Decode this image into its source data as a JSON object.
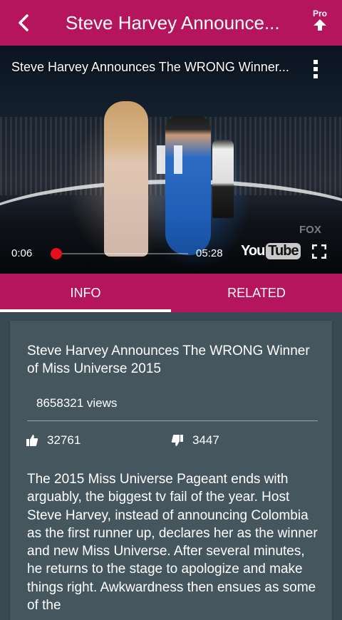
{
  "appbar": {
    "title": "Steve Harvey Announce...",
    "pro_label": "Pro"
  },
  "player": {
    "video_title": "Steve Harvey Announces The WRONG Winner...",
    "current_time": "0:06",
    "total_time": "05:28",
    "progress_fraction": 0.018,
    "youtube_logo_you": "You",
    "youtube_logo_tube": "Tube",
    "watermark": "FOX"
  },
  "tabs": [
    {
      "label": "INFO",
      "active": true
    },
    {
      "label": "RELATED",
      "active": false
    }
  ],
  "info": {
    "title": "Steve Harvey Announces The WRONG Winner of Miss Universe 2015",
    "views": "8658321 views",
    "likes": "32761",
    "dislikes": "3447",
    "description": "The 2015 Miss Universe Pageant ends with arguably, the biggest tv fail of the year. Host Steve Harvey, instead of announcing Colombia as the first runner up, declares her as the winner and new Miss Universe. After several minutes, he returns to the stage to apologize and make things right. Awkwardness then ensues as some of the"
  },
  "colors": {
    "accent": "#b5155c",
    "card_bg": "#45565f",
    "page_bg": "#3a4a54",
    "seek_thumb": "#e6101d"
  },
  "icons": [
    "back-arrow-icon",
    "pro-upload-icon",
    "overflow-menu-icon",
    "pause-icon",
    "fullscreen-icon",
    "thumbs-up-icon",
    "thumbs-down-icon"
  ]
}
